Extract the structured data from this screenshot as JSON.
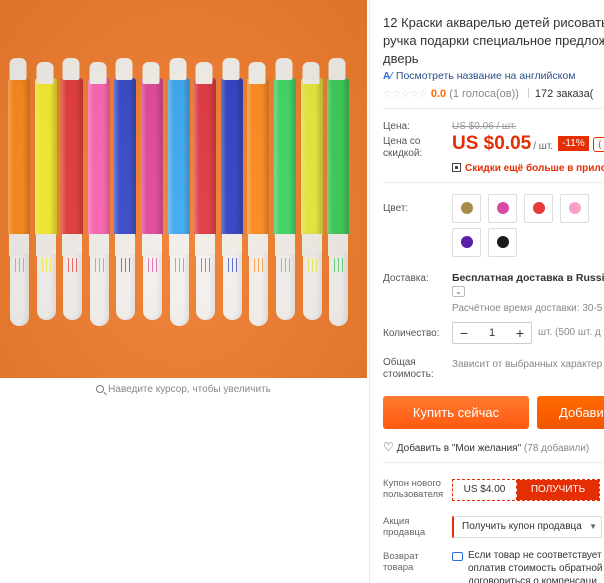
{
  "gallery": {
    "zoom_hint": "Наведите курсор, чтобы увеличить",
    "marker_colors": [
      "#ff8a1c",
      "#f8ef2c",
      "#e63a3a",
      "#ff63b0",
      "#3447c7",
      "#e0449a",
      "#3aa7f0",
      "#e0343c",
      "#2f3fc4",
      "#ff8a1c",
      "#3fd864",
      "#e8ec3a",
      "#3ccf5a"
    ]
  },
  "product": {
    "title_lines": [
      "12 Краски акварелью детей рисовать г",
      "ручка подарки специальное предложе",
      "дверь"
    ],
    "english_link": "Посмотреть название на английском",
    "english_icon": "translate-icon",
    "rating_stars": "☆☆☆☆☆",
    "rating_value": "0.0",
    "rating_count": "(1 голоса(ов))",
    "orders": "172 заказа("
  },
  "price": {
    "label_price": "Цена:",
    "old_price": "US $0.06 / шт.",
    "label_discount": "Цена со скидкой:",
    "current": "US $0.05",
    "per_unit": "/ шт.",
    "discount_badge": "-11%",
    "badge2": "(",
    "app_promo": "Скидки ещё больше в прилож"
  },
  "color": {
    "label": "Цвет:",
    "swatches": [
      "#a68a4a",
      "#d84aa0",
      "#e53a3a",
      "#f8a0c8",
      "#5a1fa6",
      "#1a1a1a"
    ]
  },
  "shipping": {
    "label": "Доставка:",
    "text": "Бесплатная доставка в Russian",
    "dropdown": "⌄",
    "time": "Расчётное время доставки: 30-5"
  },
  "quantity": {
    "label": "Количество:",
    "minus": "−",
    "value": "1",
    "plus": "+",
    "note": "шт. (500 шт. д"
  },
  "total": {
    "label": "Общая стоимость:",
    "note": "Зависит от выбранных характер"
  },
  "actions": {
    "buy_now": "Купить сейчас",
    "add_to_cart": "Добави"
  },
  "wishlist": {
    "text": "Добавить в \"Мои желания\"",
    "count": "(78 добавили)",
    "arrow": "("
  },
  "coupons": {
    "new_user_label": "Купон нового пользователя",
    "new_user_value": "US $4.00",
    "new_user_button": "ПОЛУЧИТЬ",
    "seller_label": "Акция продавца",
    "seller_select": "Получить купон продавца",
    "return_label": "Возврат товара",
    "return_text": [
      "Если товар не соответствует",
      "оплатив стоимость обратной",
      "договориться о компенсаци"
    ]
  }
}
